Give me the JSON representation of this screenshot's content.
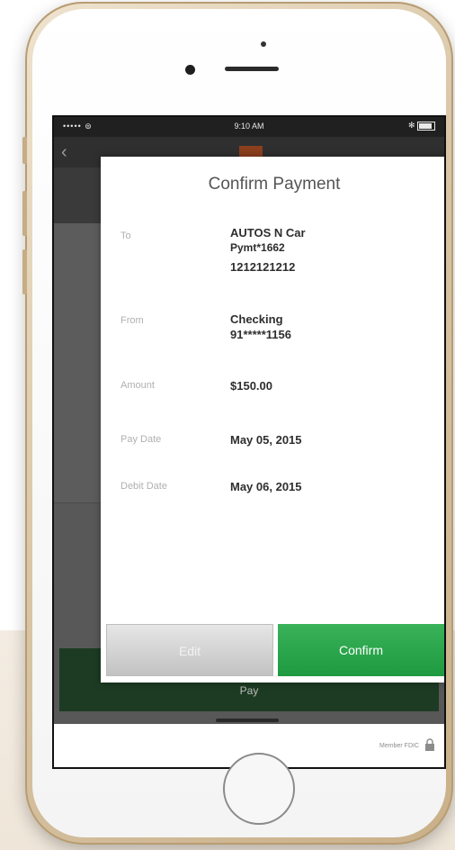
{
  "status_bar": {
    "signal": "••••• ⊜",
    "time": "9:10 AM",
    "right": "✻"
  },
  "background_app": {
    "pay_label": "Pay"
  },
  "footer": {
    "fdic_text": "Member FDIC"
  },
  "modal": {
    "title": "Confirm Payment",
    "details": [
      {
        "label": "To",
        "lines": [
          "AUTOS N Car",
          "Pymt*1662",
          "1212121212"
        ]
      },
      {
        "label": "From",
        "lines": [
          "Checking",
          "91*****1156"
        ]
      },
      {
        "label": "Amount",
        "lines": [
          "$150.00"
        ]
      },
      {
        "label": "Pay Date",
        "lines": [
          "May 05, 2015"
        ]
      },
      {
        "label": "Debit Date",
        "lines": [
          "May 06, 2015"
        ]
      }
    ],
    "edit_label": "Edit",
    "confirm_label": "Confirm"
  },
  "colors": {
    "confirm_green": "#22a045",
    "pay_bar_green": "#1d3b23",
    "phone_gold": "#d9c6a6"
  }
}
